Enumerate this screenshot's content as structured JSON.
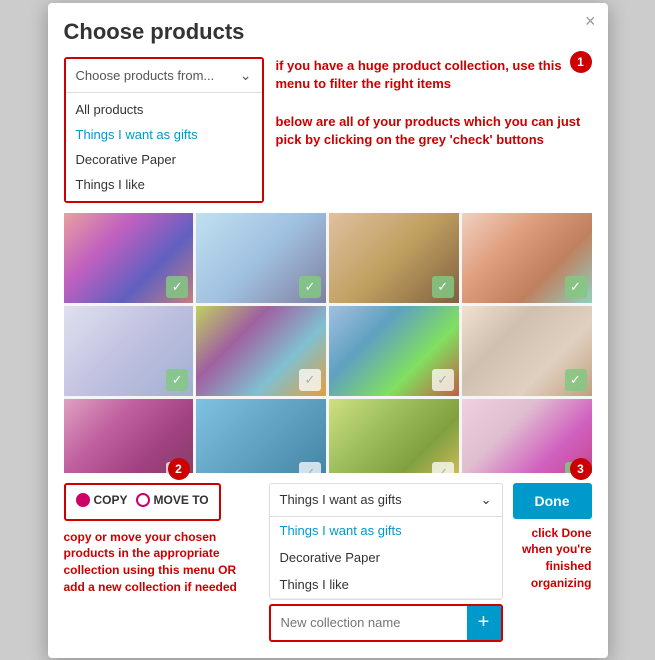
{
  "modal": {
    "title": "Choose products",
    "close_label": "×"
  },
  "filter": {
    "placeholder": "Choose products from...",
    "options": [
      {
        "id": "all",
        "label": "All products",
        "active": false
      },
      {
        "id": "gifts",
        "label": "Things I want as gifts",
        "active": true
      },
      {
        "id": "decorative",
        "label": "Decorative Paper",
        "active": false
      },
      {
        "id": "like",
        "label": "Things I like",
        "active": false
      }
    ]
  },
  "annotations": {
    "filter_hint": "if you have a huge product collection, use this menu to filter the right items",
    "grid_hint": "below are all of your products which you can just pick by clicking on the grey 'check' buttons",
    "copy_move_hint": "copy or move your chosen products in the appropriate collection using this menu\nOR\nadd a new collection if needed",
    "done_hint": "click Done when you're finished organizing"
  },
  "products": [
    {
      "id": 1,
      "checked": true
    },
    {
      "id": 2,
      "checked": true
    },
    {
      "id": 3,
      "checked": true
    },
    {
      "id": 4,
      "checked": true
    },
    {
      "id": 5,
      "checked": true
    },
    {
      "id": 6,
      "checked": false
    },
    {
      "id": 7,
      "checked": false
    },
    {
      "id": 8,
      "checked": true
    },
    {
      "id": 9,
      "checked": false
    },
    {
      "id": 10,
      "checked": false
    },
    {
      "id": 11,
      "checked": false
    },
    {
      "id": 12,
      "checked": true
    }
  ],
  "copy_move": {
    "copy_label": "COPY",
    "move_label": "MOVE TO",
    "selected": "copy"
  },
  "collection_dropdown": {
    "selected": "Things I want as gifts",
    "options": [
      {
        "id": "gifts",
        "label": "Things I want as gifts",
        "active": true
      },
      {
        "id": "decorative",
        "label": "Decorative Paper",
        "active": false
      },
      {
        "id": "like",
        "label": "Things I like",
        "active": false
      }
    ]
  },
  "new_collection": {
    "placeholder": "New collection name",
    "add_label": "+"
  },
  "done_button": {
    "label": "Done"
  },
  "badges": {
    "one": "1",
    "two": "2",
    "three": "3"
  }
}
